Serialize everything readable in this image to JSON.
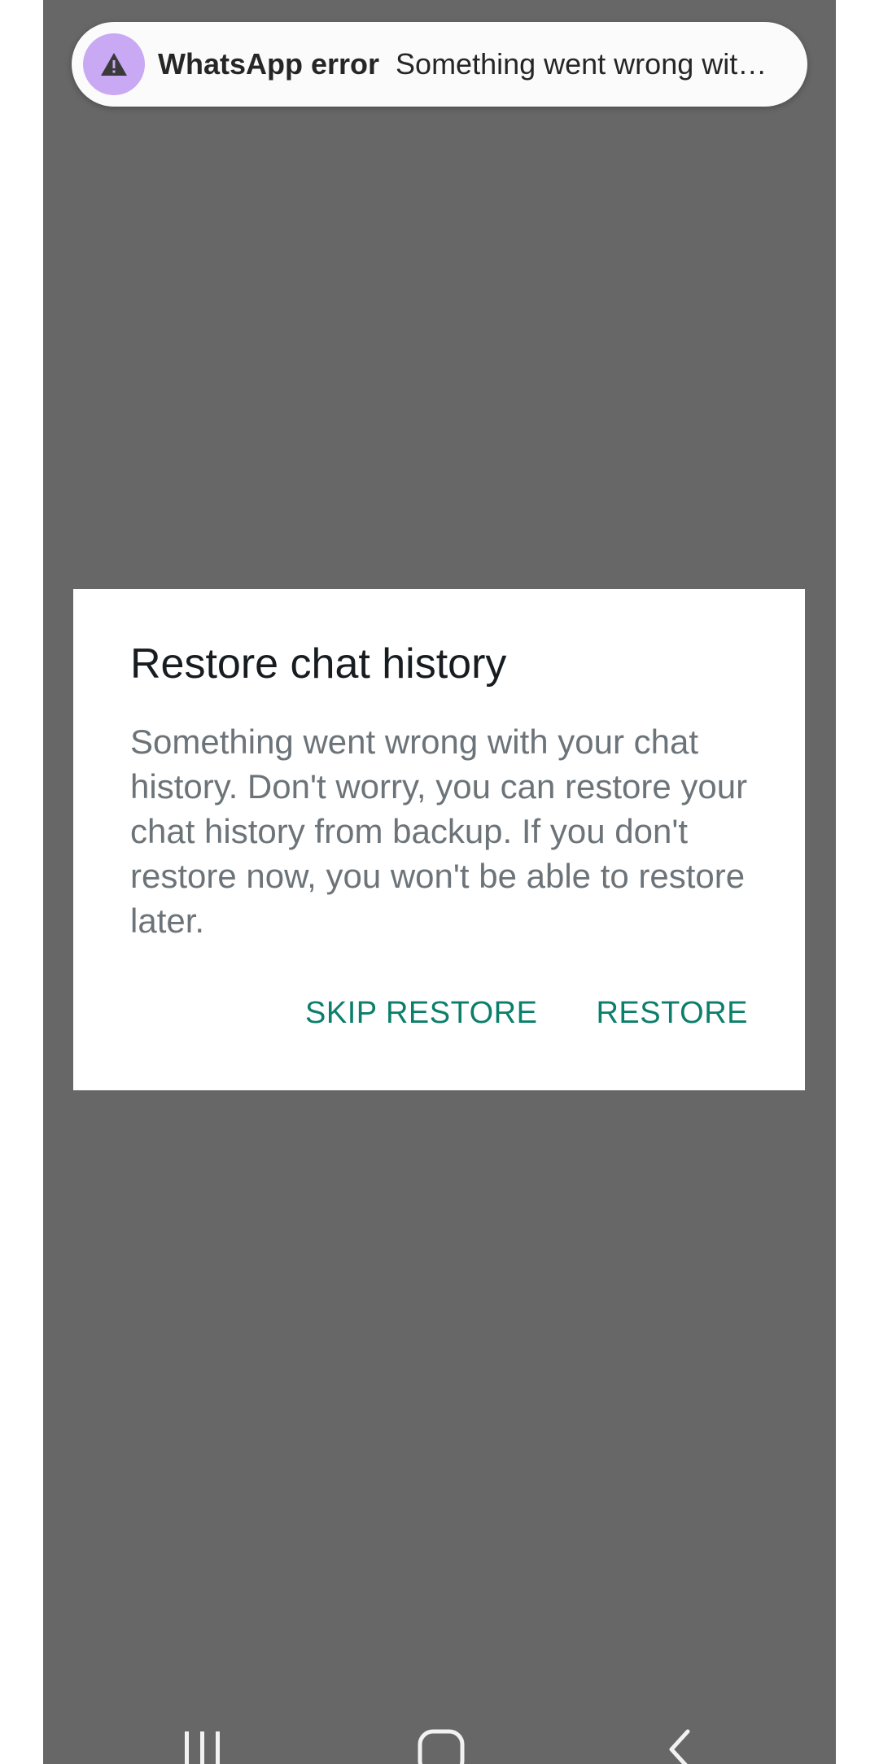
{
  "notification": {
    "icon": "warning-icon",
    "icon_bg": "#c9a8f4",
    "title": "WhatsApp error",
    "text": "Something went wrong wit…"
  },
  "dialog": {
    "title": "Restore chat history",
    "body": "Something went wrong with your chat history. Don't worry, you can restore your chat history from backup. If you don't restore now, you won't be able to restore later.",
    "skip_label": "SKIP RESTORE",
    "restore_label": "RESTORE",
    "accent": "#0b7f6b"
  },
  "navbar": {
    "recents_icon": "recents-icon",
    "home_icon": "home-icon",
    "back_icon": "back-icon"
  }
}
